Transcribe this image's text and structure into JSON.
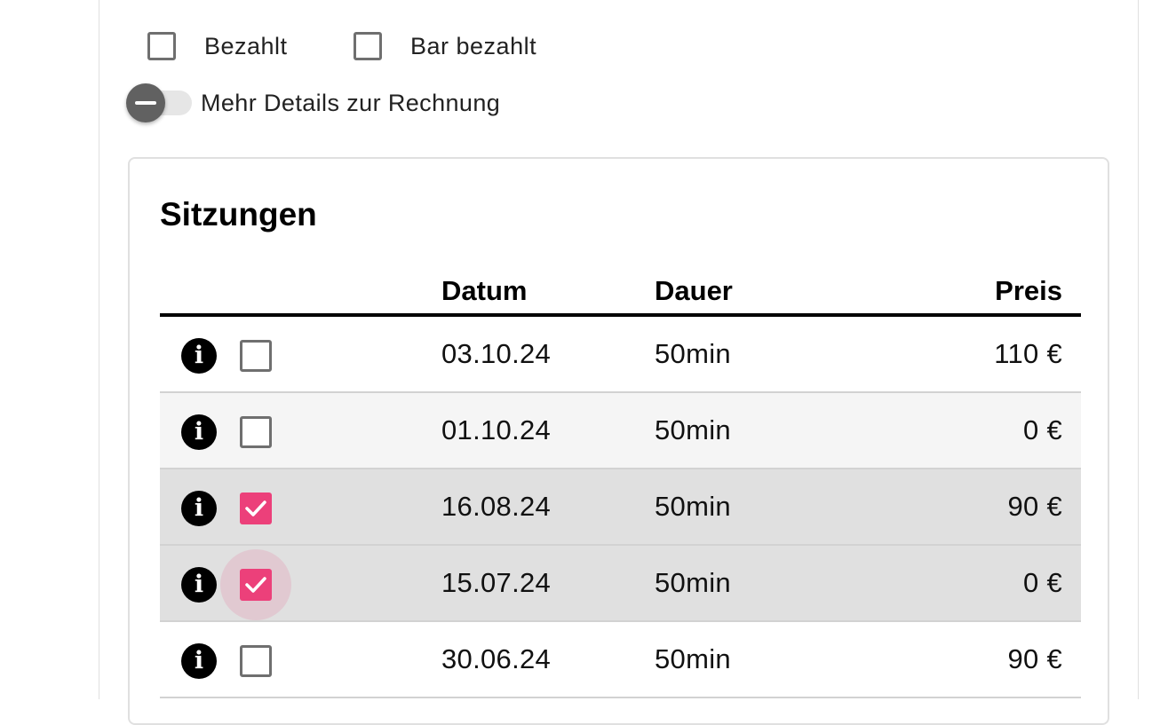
{
  "filters": {
    "paid_label": "Bezahlt",
    "paid_checked": false,
    "cash_paid_label": "Bar bezahlt",
    "cash_paid_checked": false
  },
  "details_toggle": {
    "label": "Mehr Details zur Rechnung",
    "enabled": false
  },
  "sessions": {
    "title": "Sitzungen",
    "columns": {
      "date": "Datum",
      "duration": "Dauer",
      "price": "Preis"
    },
    "rows": [
      {
        "date": "03.10.24",
        "duration": "50min",
        "price": "110 €",
        "selected": false
      },
      {
        "date": "01.10.24",
        "duration": "50min",
        "price": "0 €",
        "selected": false
      },
      {
        "date": "16.08.24",
        "duration": "50min",
        "price": "90 €",
        "selected": true
      },
      {
        "date": "15.07.24",
        "duration": "50min",
        "price": "0 €",
        "selected": true
      },
      {
        "date": "30.06.24",
        "duration": "50min",
        "price": "90 €",
        "selected": false
      }
    ]
  },
  "icons": {
    "info": "info-icon",
    "check": "check-icon"
  },
  "colors": {
    "accent": "#ec407a",
    "selected_row": "#e0e0e0",
    "alt_row": "#f5f5f5"
  }
}
